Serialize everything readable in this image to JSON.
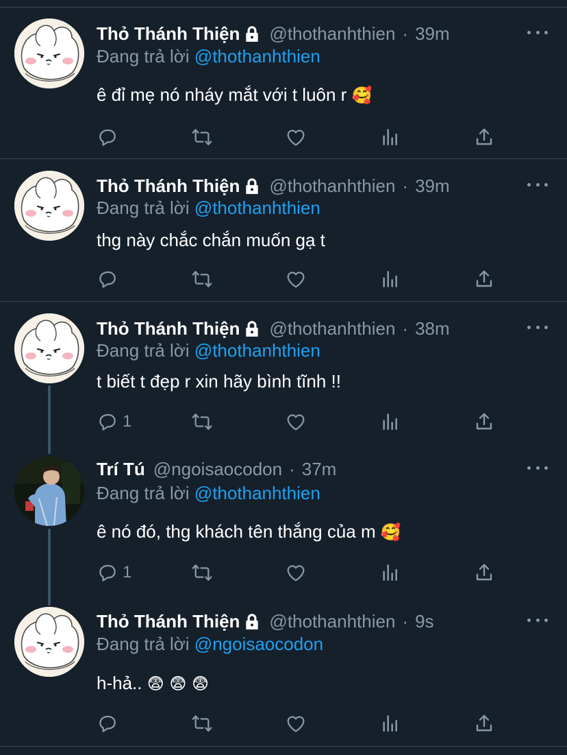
{
  "tweets": [
    {
      "author_name": "Thỏ Thánh Thiện",
      "handle": "@thothanhthien",
      "separator": "·",
      "time": "39m",
      "replying_label": "Đang trả lời",
      "replying_to": "@thothanhthien",
      "text": "ê đỉ mẹ nó nháy mắt với t luôn r",
      "emoji": "🥰",
      "reply_count": "",
      "locked": true,
      "avatar": "bunny"
    },
    {
      "author_name": "Thỏ Thánh Thiện",
      "handle": "@thothanhthien",
      "separator": "·",
      "time": "39m",
      "replying_label": "Đang trả lời",
      "replying_to": "@thothanhthien",
      "text": "thg này chắc chắn muốn gạ t",
      "emoji": "",
      "reply_count": "",
      "locked": true,
      "avatar": "bunny"
    },
    {
      "author_name": "Thỏ Thánh Thiện",
      "handle": "@thothanhthien",
      "separator": "·",
      "time": "38m",
      "replying_label": "Đang trả lời",
      "replying_to": "@thothanhthien",
      "text": "t biết t đẹp r xin hãy bình tĩnh !!",
      "emoji": "",
      "reply_count": "1",
      "locked": true,
      "avatar": "bunny"
    },
    {
      "author_name": "Trí Tú",
      "handle": "@ngoisaocodon",
      "separator": "·",
      "time": "37m",
      "replying_label": "Đang trả lời",
      "replying_to": "@thothanhthien",
      "text": "ê nó đó, thg khách tên thắng của m",
      "emoji": "🥰",
      "reply_count": "1",
      "locked": false,
      "avatar": "person"
    },
    {
      "author_name": "Thỏ Thánh Thiện",
      "handle": "@thothanhthien",
      "separator": "·",
      "time": "9s",
      "replying_label": "Đang trả lời",
      "replying_to": "@ngoisaocodon",
      "text": "h-hả..",
      "emoji": "😨 😨 😨",
      "reply_count": "",
      "locked": true,
      "avatar": "bunny"
    }
  ],
  "icons": {
    "reply": "reply-icon",
    "retweet": "retweet-icon",
    "like": "heart-icon",
    "analytics": "analytics-icon",
    "share": "share-icon",
    "more": "more-icon",
    "lock": "lock-icon"
  },
  "colors": {
    "background": "#15202b",
    "text": "#ffffff",
    "secondary": "#8899a6",
    "mention": "#1da1f2",
    "divider": "#38444d"
  }
}
